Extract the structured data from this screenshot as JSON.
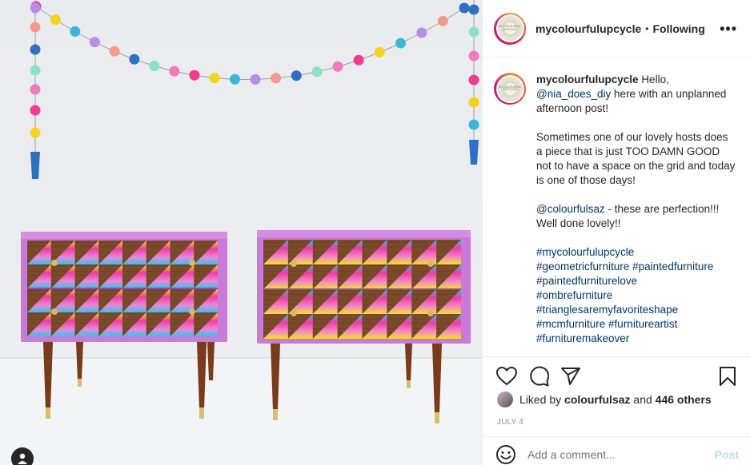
{
  "post": {
    "username": "mycolourfulupcycle",
    "separator": "•",
    "follow_status": "Following",
    "more_label": "•••",
    "avatar_text": "MY COLOURFUL UPCYCLE"
  },
  "caption": {
    "username": "mycolourfulupcycle",
    "intro": "Hello,",
    "mention1": "@nia_does_diy",
    "intro_rest": "here with an unplanned afternoon post!",
    "para2": "Sometimes one of our lovely hosts does a piece that is just TOO DAMN GOOD not to have a space on the grid and today is one of those days!",
    "mention2": "@colourfulsaz",
    "para3_rest": "- these are perfection!!! Well done lovely!!",
    "hashtags": [
      "#mycolourfulupcycle",
      "#geometricfurniture",
      "#paintedfurniture",
      "#paintedfurniturelove",
      "#ombrefurniture",
      "#trianglesaremyfavoriteshape",
      "#mcmfurniture",
      "#furnitureartist",
      "#furnituremakeover"
    ]
  },
  "likes": {
    "prefix": "Liked by",
    "user": "colourfulsaz",
    "and": "and",
    "count": "446 others"
  },
  "date": "JULY 4",
  "comment": {
    "placeholder": "Add a comment...",
    "post_label": "Post"
  },
  "colors": {
    "link": "#00376b",
    "post_disabled": "#b2dffc",
    "muted": "#8e8e8e"
  },
  "icons": [
    "heart-icon",
    "comment-icon",
    "share-icon",
    "bookmark-icon",
    "emoji-icon",
    "user-tag-icon",
    "more-icon"
  ]
}
